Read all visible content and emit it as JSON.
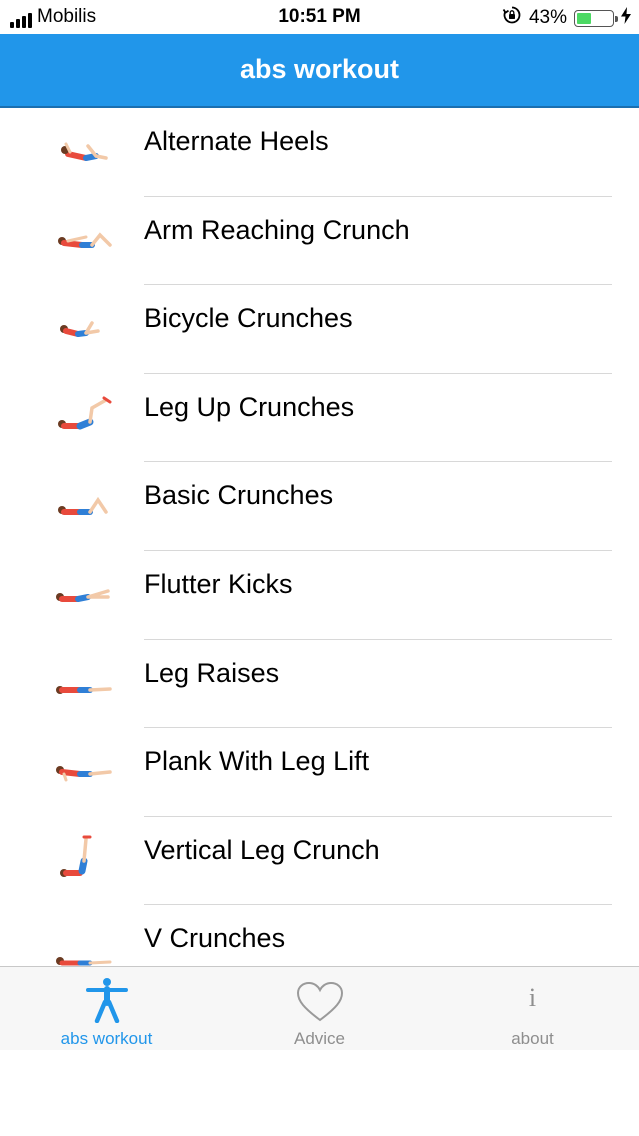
{
  "status_bar": {
    "carrier": "Mobilis",
    "time": "10:51 PM",
    "battery_percent": "43%",
    "battery_level": 0.43
  },
  "nav": {
    "title": "abs workout"
  },
  "exercises": [
    {
      "label": "Alternate Heels",
      "icon": "alternate-heels-figure"
    },
    {
      "label": "Arm Reaching Crunch",
      "icon": "arm-reaching-crunch-figure"
    },
    {
      "label": "Bicycle Crunches",
      "icon": "bicycle-crunches-figure"
    },
    {
      "label": "Leg Up Crunches",
      "icon": "leg-up-crunches-figure"
    },
    {
      "label": "Basic Crunches",
      "icon": "basic-crunches-figure"
    },
    {
      "label": "Flutter Kicks",
      "icon": "flutter-kicks-figure"
    },
    {
      "label": "Leg Raises",
      "icon": "leg-raises-figure"
    },
    {
      "label": "Plank With Leg Lift",
      "icon": "plank-leg-lift-figure"
    },
    {
      "label": "Vertical Leg Crunch",
      "icon": "vertical-leg-crunch-figure"
    },
    {
      "label": "V Crunches",
      "icon": "v-crunches-figure"
    }
  ],
  "tabs": [
    {
      "label": "abs workout",
      "icon": "person-icon",
      "active": true
    },
    {
      "label": "Advice",
      "icon": "heart-icon",
      "active": false
    },
    {
      "label": "about",
      "icon": "info-icon",
      "active": false
    }
  ],
  "colors": {
    "accent": "#2196ea",
    "shirt": "#e84a3c",
    "shorts": "#2f7fd6",
    "skin": "#f2c9a8"
  }
}
